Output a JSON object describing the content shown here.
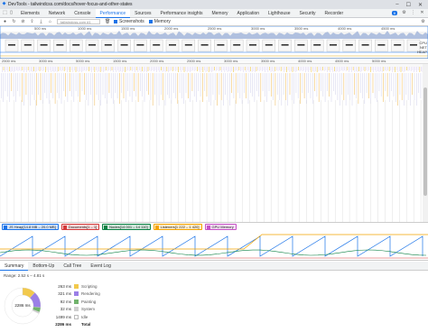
{
  "window": {
    "title": "DevTools - tailwindcss.com/docs/hover-focus-and-other-states"
  },
  "tabs": [
    "Elements",
    "Network",
    "Console",
    "Performance",
    "Sources",
    "Performance insights",
    "Memory",
    "Application",
    "Lighthouse",
    "Security",
    "Recorder"
  ],
  "active_tab": "Performance",
  "tabbar_right": {
    "issues_count": "6"
  },
  "toolbar": {
    "profile_select": "tailwindcss.com #1",
    "screenshots_label": "Screenshots",
    "memory_label": "Memory"
  },
  "ruler_top": [
    "500 ms",
    "1000 ms",
    "1500 ms",
    "2000 ms",
    "2500 ms",
    "3000 ms",
    "3500 ms",
    "4000 ms",
    "4500 ms"
  ],
  "ruler_main": [
    "2500 ms",
    "3000 ms",
    "5000 ms",
    "1500 ms",
    "2000 ms",
    "2500 ms",
    "3000 ms",
    "3500 ms",
    "4000 ms",
    "4500 ms",
    "5000 ms"
  ],
  "side_labels": [
    "CPU",
    "NET",
    "HEAP"
  ],
  "counters": [
    {
      "label": "JS Heap[14.8 MB – 20.0 MB]",
      "color": "#1a73e8"
    },
    {
      "label": "Documents[1 – 1]",
      "color": "#d33a3a"
    },
    {
      "label": "Nodes[14 001 – 14 110]",
      "color": "#0b8043"
    },
    {
      "label": "Listeners[1 222 – 1 420]",
      "color": "#f4a300"
    },
    {
      "label": "GPU Memory",
      "color": "#c653c6"
    }
  ],
  "bottom_tabs": [
    "Summary",
    "Bottom-Up",
    "Call Tree",
    "Event Log"
  ],
  "active_bottom_tab": "Summary",
  "range_text": "Range: 2.52 s – 4.81 s",
  "summary": {
    "donut_center": "2286 ms",
    "rows": [
      {
        "ms": "263 ms",
        "label": "Scripting",
        "color": "#f2c94c",
        "value": 263
      },
      {
        "ms": "321 ms",
        "label": "Rendering",
        "color": "#9b7fe6",
        "value": 321
      },
      {
        "ms": "92 ms",
        "label": "Painting",
        "color": "#71b36c",
        "value": 92
      },
      {
        "ms": "32 ms",
        "label": "System",
        "color": "#cfcfcf",
        "value": 32
      },
      {
        "ms": "1499 ms",
        "label": "Idle",
        "color": "#ffffff",
        "value": 1499
      }
    ],
    "total_ms": "2286 ms",
    "total_label": "Total"
  }
}
